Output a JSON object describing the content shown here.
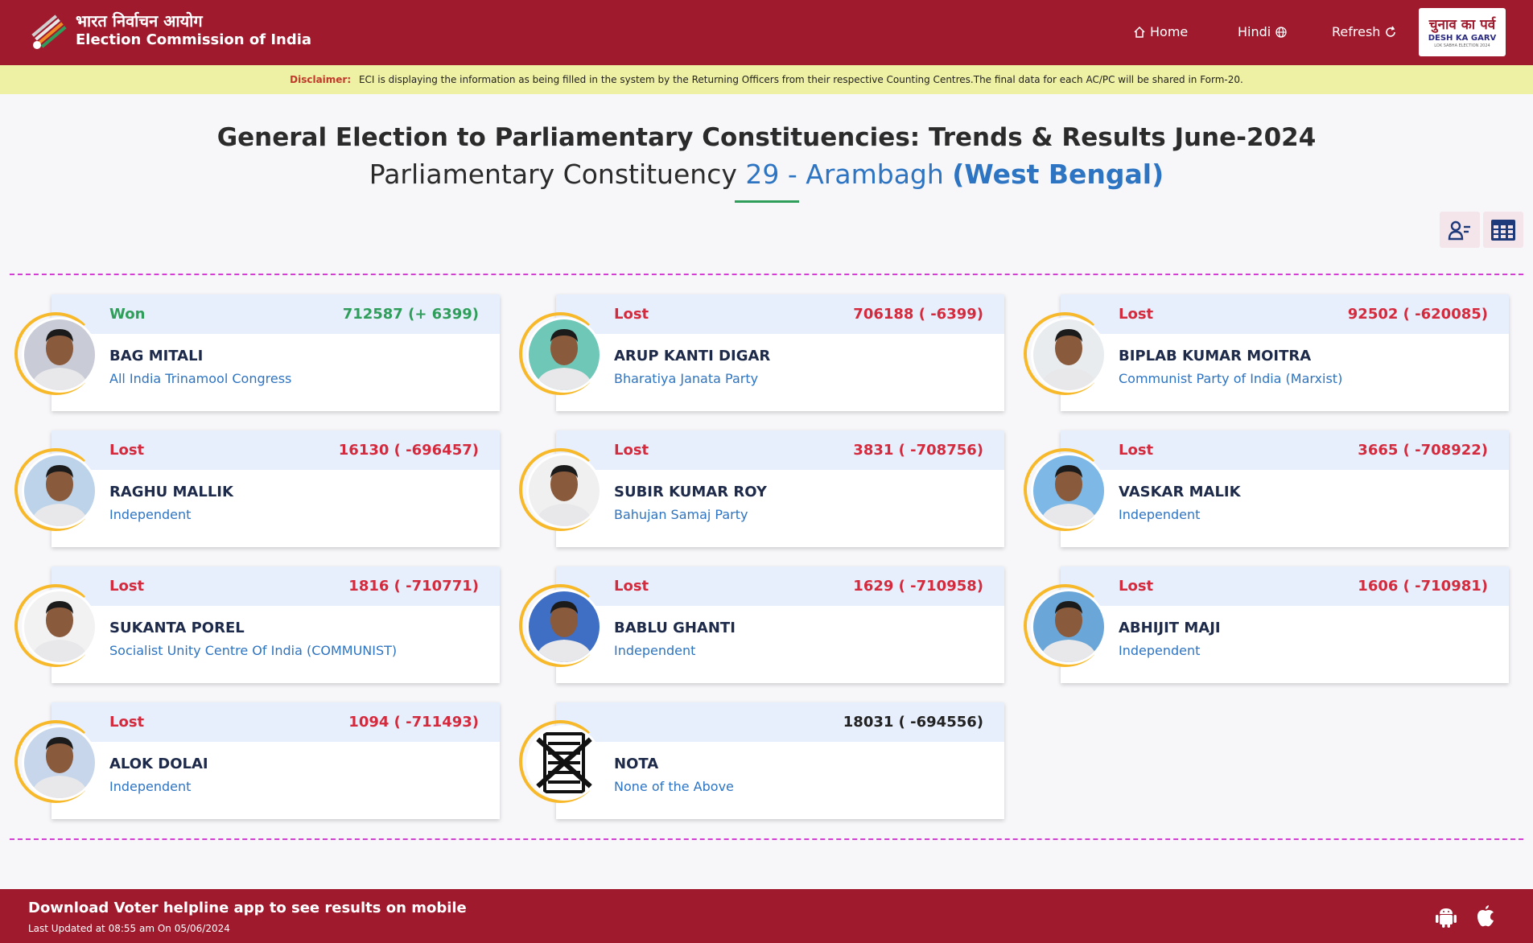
{
  "header": {
    "logo_hindi": "भारत निर्वाचन आयोग",
    "logo_english": "Election Commission of India",
    "nav": {
      "home": "Home",
      "hindi": "Hindi",
      "refresh": "Refresh"
    },
    "badge": {
      "line1": "चुनाव का पर्व",
      "line2": "DESH KA GARV",
      "line3": "LOK SABHA ELECTION 2024"
    },
    "brand_color": "#a01a2e"
  },
  "disclaimer": {
    "label": "Disclaimer:",
    "text": "ECI is displaying the information as being filled in the system by the Returning Officers from their respective Counting Centres.The final data for each AC/PC will be shared in Form-20."
  },
  "title": {
    "main": "General Election to Parliamentary Constituencies: Trends & Results June-2024",
    "pc_prefix": "Parliamentary Constituency",
    "pc_name": "29 - Arambagh",
    "state": "(West Bengal)"
  },
  "candidates": [
    {
      "status": "Won",
      "votes": "712587 (+ 6399)",
      "name": "BAG MITALI",
      "party": "All India Trinamool Congress",
      "photo_bg": "#c9ccd6"
    },
    {
      "status": "Lost",
      "votes": "706188 ( -6399)",
      "name": "ARUP KANTI DIGAR",
      "party": "Bharatiya Janata Party",
      "photo_bg": "#6fc7b8"
    },
    {
      "status": "Lost",
      "votes": "92502 ( -620085)",
      "name": "BIPLAB KUMAR MOITRA",
      "party": "Communist Party of India (Marxist)",
      "photo_bg": "#e9ecef"
    },
    {
      "status": "Lost",
      "votes": "16130 ( -696457)",
      "name": "RAGHU MALLIK",
      "party": "Independent",
      "photo_bg": "#bcd3ea"
    },
    {
      "status": "Lost",
      "votes": "3831 ( -708756)",
      "name": "SUBIR KUMAR ROY",
      "party": "Bahujan Samaj Party",
      "photo_bg": "#f0f0f0"
    },
    {
      "status": "Lost",
      "votes": "3665 ( -708922)",
      "name": "VASKAR MALIK",
      "party": "Independent",
      "photo_bg": "#7db8e6"
    },
    {
      "status": "Lost",
      "votes": "1816 ( -710771)",
      "name": "SUKANTA POREL",
      "party": "Socialist Unity Centre Of India (COMMUNIST)",
      "photo_bg": "#f2f2f2"
    },
    {
      "status": "Lost",
      "votes": "1629 ( -710958)",
      "name": "BABLU GHANTI",
      "party": "Independent",
      "photo_bg": "#3e6fc4"
    },
    {
      "status": "Lost",
      "votes": "1606 ( -710981)",
      "name": "ABHIJIT MAJI",
      "party": "Independent",
      "photo_bg": "#6aa7d8"
    },
    {
      "status": "Lost",
      "votes": "1094 ( -711493)",
      "name": "ALOK DOLAI",
      "party": "Independent",
      "photo_bg": "#c7d6ea"
    },
    {
      "status": "",
      "votes": "18031 ( -694556)",
      "name": "NOTA",
      "party": "None of the Above",
      "photo_bg": "#ffffff"
    }
  ],
  "footer": {
    "line1": "Download Voter helpline app to see results on mobile",
    "line2": "Last Updated at 08:55 am On 05/06/2024"
  },
  "icons": [
    "ballot-logo-icon",
    "home-icon",
    "globe-icon",
    "refresh-icon",
    "candidate-view-icon",
    "table-view-icon",
    "android-icon",
    "apple-icon"
  ]
}
